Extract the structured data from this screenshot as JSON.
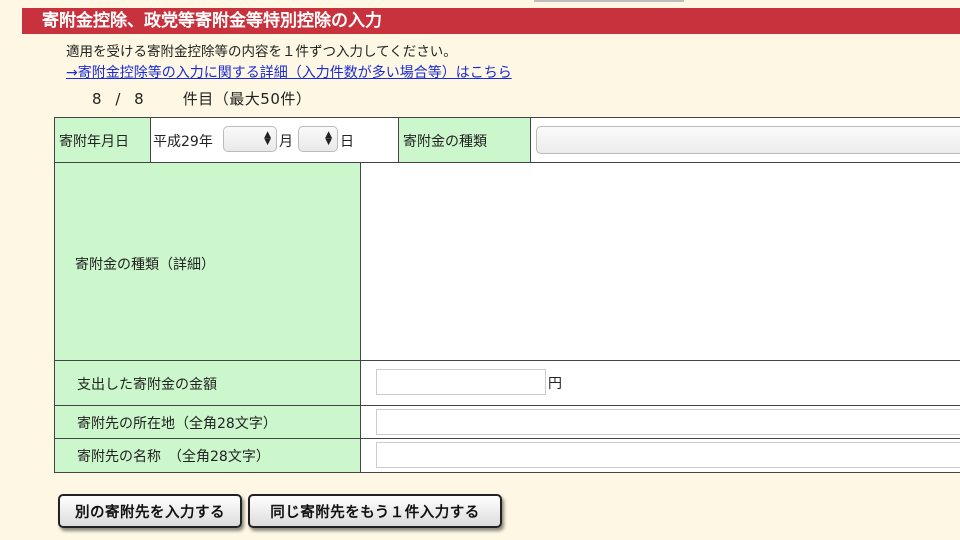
{
  "section_title": "寄附金控除、政党等寄附金等特別控除の入力",
  "instruction": "適用を受ける寄附金控除等の内容を１件ずつ入力してください。",
  "detail_link": "→寄附金控除等の入力に関する詳細（入力件数が多い場合等）はこちら",
  "counter": {
    "current": "8",
    "sep": "/",
    "total": "8",
    "suffix": "件目（最大50件）"
  },
  "form": {
    "date_label": "寄附年月日",
    "era_year": "平成29年",
    "month_unit": "月",
    "day_unit": "日",
    "type_label": "寄附金の種類",
    "type_detail_label": "寄附金の種類（詳細）",
    "amount_label": "支出した寄附金の金額",
    "amount_unit": "円",
    "address_label": "寄附先の所在地（全角28文字）",
    "name_label": "寄附先の名称　（全角28文字）"
  },
  "buttons": {
    "another": "別の寄附先を入力する",
    "same": "同じ寄附先をもう１件入力する"
  },
  "colors": {
    "title_bg": "#c8323c",
    "label_bg": "#ccf7cc",
    "page_bg": "#fdf7e3",
    "link": "#1a2bd6"
  }
}
